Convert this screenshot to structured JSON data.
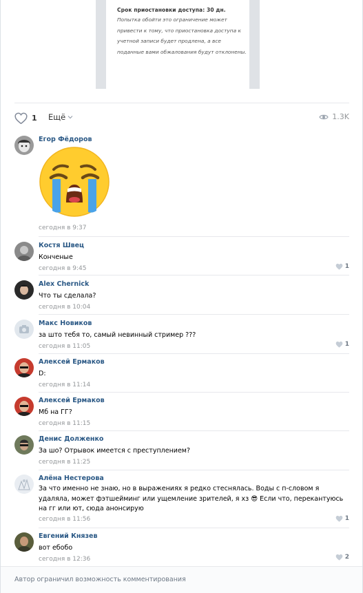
{
  "attachment": {
    "title": "Срок приостановки доступа: 30 дн.",
    "body": "Попытка обойти это ограничение может привести к тому, что приостановка доступа к учетной записи будет продлена, а все поданные вами обжалования будут отклонены."
  },
  "actions": {
    "like_count": "1",
    "more_label": "Ещё",
    "views": "1.3K"
  },
  "comments": [
    {
      "author": "Егор Фёдоров",
      "text": "",
      "sticker": "crying-face-sticker",
      "date": "сегодня в 9:37",
      "likes": ""
    },
    {
      "author": "Костя Швец",
      "text": "Конченые",
      "date": "сегодня в 9:45",
      "likes": "1"
    },
    {
      "author": "Alex Chernick",
      "text": "Что ты сделала?",
      "date": "сегодня в 10:04",
      "likes": ""
    },
    {
      "author": "Макс Новиков",
      "text": "за што тебя то, самый невинный стример ???",
      "date": "сегодня в 11:05",
      "likes": "1"
    },
    {
      "author": "Алексей Ермаков",
      "text": "D:",
      "date": "сегодня в 11:14",
      "likes": ""
    },
    {
      "author": "Алексей Ермаков",
      "text": "Мб на ГГ?",
      "date": "сегодня в 11:15",
      "likes": ""
    },
    {
      "author": "Денис Долженко",
      "text": "За шо? Отрывок имеется с преступлением?",
      "date": "сегодня в 11:25",
      "likes": ""
    },
    {
      "author": "Алёна Нестерова",
      "text": "За что именно не знаю, но в выражениях я редко стеснялась. Воды с п-словом я удаляла, может фэтшейминг или ущемление зрителей, я хз 😎 Если что, перекантуюсь на гг или ют, сюда анонсирую",
      "date": "сегодня в 11:56",
      "likes": "1"
    },
    {
      "author": "Евгений Князев",
      "text": "вот ебобо",
      "date": "сегодня в 12:36",
      "likes": "2"
    }
  ],
  "footer": {
    "text": "Автор ограничил возможность комментирования"
  },
  "colors": {
    "link": "#2a5885",
    "muted": "#939699",
    "divider": "#e7e8ec"
  }
}
